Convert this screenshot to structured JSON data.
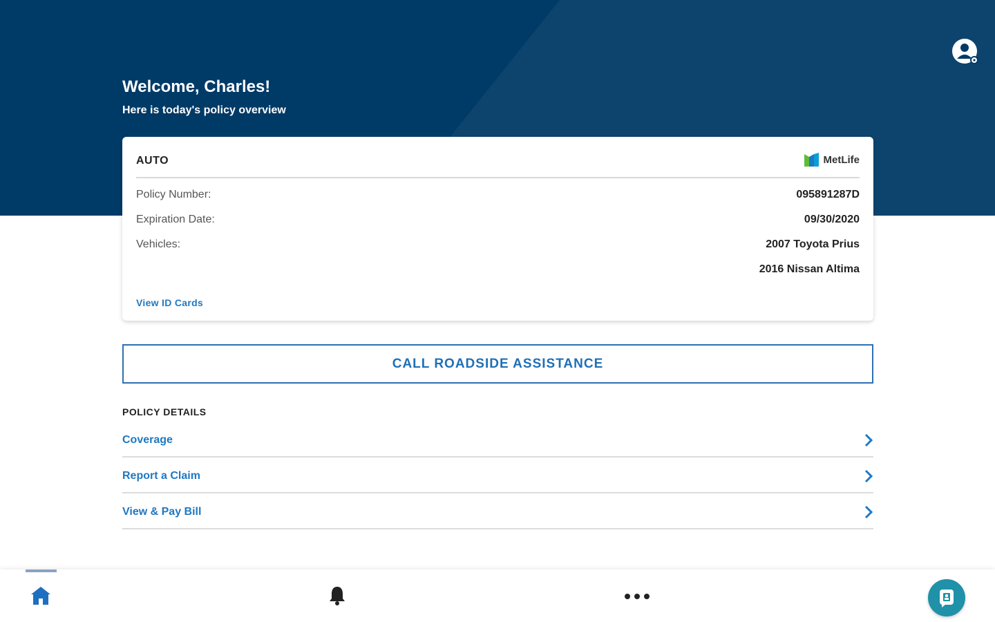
{
  "header": {
    "welcome": "Welcome, Charles!",
    "subtitle": "Here is today's policy overview",
    "profile_icon": "user-account-icon"
  },
  "policy_card": {
    "type": "AUTO",
    "carrier": "MetLife",
    "rows": [
      {
        "label": "Policy Number:",
        "value": "095891287D"
      },
      {
        "label": "Expiration Date:",
        "value": "09/30/2020"
      },
      {
        "label": "Vehicles:",
        "value": "2007 Toyota Prius"
      }
    ],
    "extra_vehicle": "2016 Nissan Altima",
    "id_link": "View ID Cards"
  },
  "roadside_button": "CALL ROADSIDE ASSISTANCE",
  "policy_details": {
    "title": "POLICY DETAILS",
    "items": [
      {
        "label": "Coverage"
      },
      {
        "label": "Report a Claim"
      },
      {
        "label": "View & Pay Bill"
      }
    ]
  },
  "bottom_nav": {
    "items": [
      "home-icon",
      "bell-icon",
      "more-icon",
      "chat-icon"
    ],
    "active": "home-icon"
  },
  "colors": {
    "header_bg": "#003a67",
    "link_blue": "#1f78c1",
    "fab_teal": "#1f91a8"
  }
}
